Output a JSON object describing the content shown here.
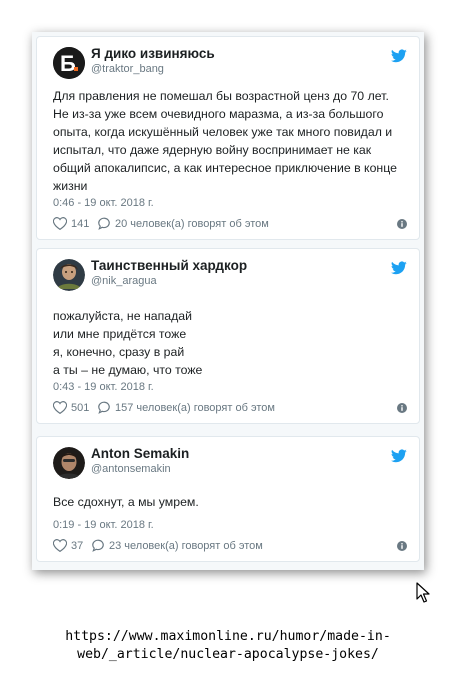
{
  "tweets": [
    {
      "name": "Я дико извиняюсь",
      "handle": "@traktor_bang",
      "avatar": "b-letter-logo-avatar",
      "text_lines": [
        "Для правления не помешал бы возрастной ценз до 70 лет.",
        "Не из-за уже всем очевидного маразма, а из-за большого",
        "опыта, когда искушённый человек уже так много повидал и",
        "испытал, что даже ядерную войну воспринимает не как",
        "общий апокалипсис, а как интересное приключение в конце",
        "жизни"
      ],
      "time": "0:46 - 19 окт. 2018 г.",
      "likes": "141",
      "talking": "20 человек(а) говорят об этом"
    },
    {
      "name": "Таинственный хардкор",
      "handle": "@nik_aragua",
      "avatar": "portrait-avatar",
      "text_lines": [
        "пожалуйста, не нападай",
        "или мне придётся тоже",
        "я, конечно, сразу в рай",
        "а ты – не думаю, что тоже"
      ],
      "time": "0:43 - 19 окт. 2018 г.",
      "likes": "501",
      "talking": "157 человек(а) говорят об этом"
    },
    {
      "name": "Anton Semakin",
      "handle": "@antonsemakin",
      "avatar": "photo-avatar",
      "text_lines": [
        "Все сдохнут, а мы умрем."
      ],
      "time": "0:19 - 19 окт. 2018 г.",
      "likes": "37",
      "talking": "23 человек(а) говорят об этом"
    }
  ],
  "source_lines": [
    "https://www.maximonline.ru/humor/made-in-",
    "web/_article/nuclear-apocalypse-jokes/"
  ],
  "colors": {
    "twitter_blue": "#1da1f2",
    "secondary_text": "#697882",
    "primary_text": "#1c2022",
    "logo_orange": "#f26b21"
  },
  "icons": [
    "twitter-bird-icon",
    "heart-icon",
    "reply-bubble-icon",
    "info-icon",
    "mouse-cursor-icon"
  ]
}
